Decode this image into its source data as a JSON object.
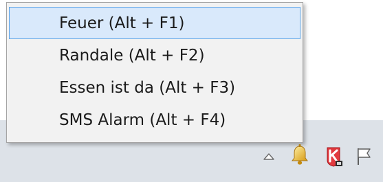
{
  "context_menu": {
    "items": [
      {
        "label": "Feuer (Alt + F1)",
        "active": true
      },
      {
        "label": "Randale (Alt + F2)",
        "active": false
      },
      {
        "label": "Essen ist da (Alt + F3)",
        "active": false
      },
      {
        "label": "SMS Alarm (Alt + F4)",
        "active": false
      }
    ]
  },
  "tray": {
    "icons": [
      "chevron-up-icon",
      "bell-icon",
      "kaspersky-icon",
      "flag-icon"
    ]
  },
  "colors": {
    "highlight_fill": "#d9e9fb",
    "highlight_border": "#5ca4e8",
    "menu_background": "#f2f2f2",
    "taskbar": "#dde2e8"
  }
}
